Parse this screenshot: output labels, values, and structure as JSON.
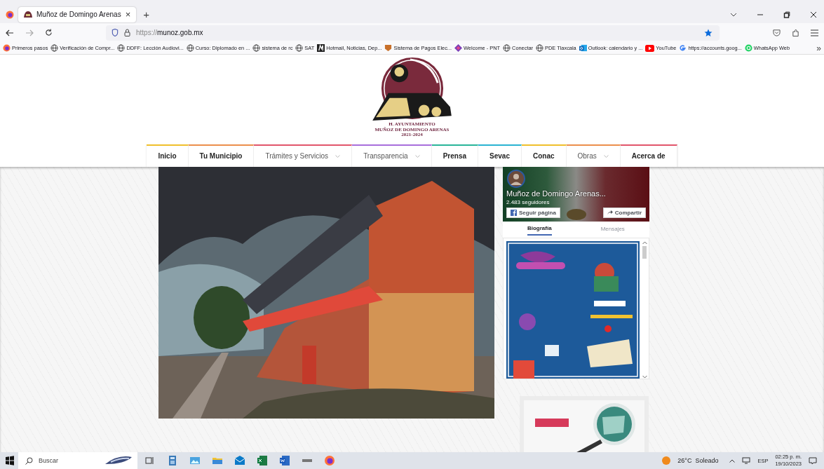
{
  "browser": {
    "tabs": [
      {
        "title": "Muñoz de Domingo Arenas",
        "selected": true
      }
    ],
    "close_tab": "×",
    "new_tab": "+",
    "url_scheme": "https://",
    "url_host": "munoz.gob.mx",
    "bookmarks": [
      {
        "label": "Primeros pasos",
        "kind": "firefox"
      },
      {
        "label": "Verificación de Compr...",
        "kind": "globe"
      },
      {
        "label": "DDFF: Lección Audiovi...",
        "kind": "globe"
      },
      {
        "label": "Curso: Diplomado en ...",
        "kind": "globe"
      },
      {
        "label": "sistema de rc",
        "kind": "globe"
      },
      {
        "label": "SAT",
        "kind": "globe"
      },
      {
        "label": "Hotmail, Noticias, Dep...",
        "kind": "msn"
      },
      {
        "label": "Sistema de Pagos Elec...",
        "kind": "shield"
      },
      {
        "label": "Welcome - PNT",
        "kind": "pnt"
      },
      {
        "label": "Conectar",
        "kind": "globe"
      },
      {
        "label": "PDE Tlaxcala",
        "kind": "globe"
      },
      {
        "label": "Outlook: calendario y ...",
        "kind": "outlook"
      },
      {
        "label": "YouTube",
        "kind": "youtube"
      },
      {
        "label": "https://accounts.goog...",
        "kind": "google"
      },
      {
        "label": "WhatsApp Web",
        "kind": "whatsapp"
      }
    ],
    "more": "»"
  },
  "site": {
    "logo": {
      "line_1": "H. AYUNTAMIENTO",
      "line_2": "MUÑOZ DE DOMINGO ARENAS",
      "line_3": "2021-2024"
    },
    "menu": [
      {
        "label": "Inicio",
        "color": "#f0c02c",
        "dropdown": false
      },
      {
        "label": "Tu Municipio",
        "color": "#ec8f4c",
        "dropdown": false
      },
      {
        "label": "Trámites y Servicios",
        "color": "#e2566b",
        "dropdown": true
      },
      {
        "label": "Transparencia",
        "color": "#a96fdc",
        "dropdown": true
      },
      {
        "label": "Prensa",
        "color": "#2ab59a",
        "dropdown": false
      },
      {
        "label": "Sevac",
        "color": "#2bb4d2",
        "dropdown": false
      },
      {
        "label": "Conac",
        "color": "#f0c02c",
        "dropdown": false
      },
      {
        "label": "Obras",
        "color": "#ec8f4c",
        "dropdown": true
      },
      {
        "label": "Acerca de",
        "color": "#e2566b",
        "dropdown": false
      }
    ],
    "facebook": {
      "page_name": "Muñoz de Domingo Arenas...",
      "followers": "2.483 seguidores",
      "follow": "Seguir página",
      "share": "Compartir",
      "tabs": [
        {
          "label": "Biografía",
          "selected": true
        },
        {
          "label": "Mensajes",
          "selected": false
        }
      ]
    }
  },
  "taskbar": {
    "search_placeholder": "Buscar",
    "weather": "26°C  Soleado",
    "language": "ESP",
    "time": "02:25 p. m.",
    "date": "19/10/2023"
  }
}
